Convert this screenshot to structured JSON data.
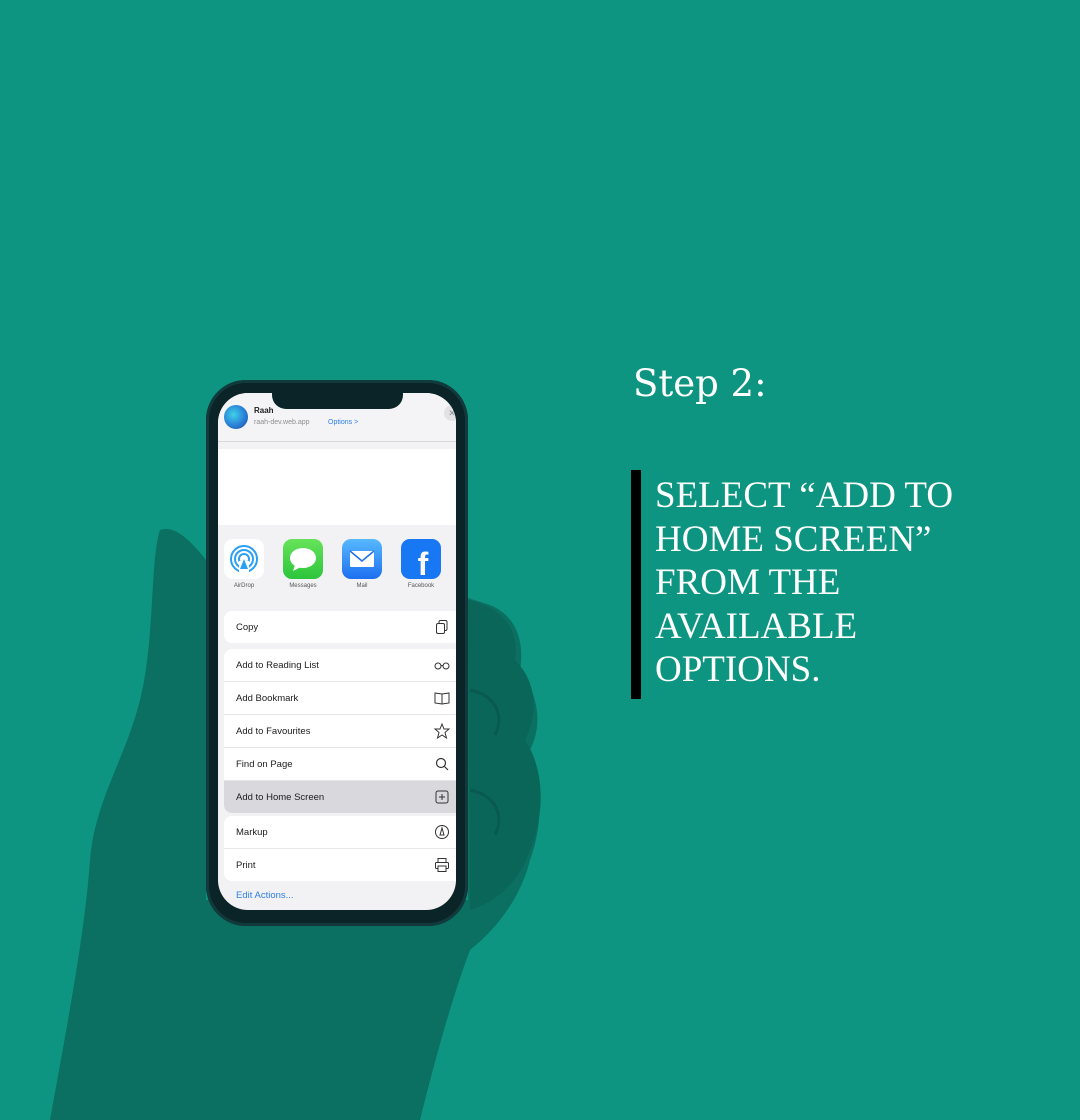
{
  "phone": {
    "share_header": {
      "app_name": "Raah",
      "url": "raah-dev.web.app",
      "options_link": "Options >",
      "close_icon": "close-icon"
    },
    "share_apps": [
      {
        "label": "AirDrop",
        "icon": "airdrop-icon"
      },
      {
        "label": "Messages",
        "icon": "messages-icon"
      },
      {
        "label": "Mail",
        "icon": "mail-icon"
      },
      {
        "label": "Facebook",
        "icon": "facebook-icon"
      }
    ],
    "actions_group1": [
      {
        "label": "Copy",
        "icon": "copy-icon"
      }
    ],
    "actions_group2": [
      {
        "label": "Add to Reading List",
        "icon": "glasses-icon"
      },
      {
        "label": "Add Bookmark",
        "icon": "book-icon"
      },
      {
        "label": "Add to Favourites",
        "icon": "star-icon"
      },
      {
        "label": "Find on Page",
        "icon": "search-icon"
      },
      {
        "label": "Add to Home Screen",
        "icon": "add-square-icon",
        "selected": true
      }
    ],
    "actions_group3": [
      {
        "label": "Markup",
        "icon": "markup-icon"
      },
      {
        "label": "Print",
        "icon": "printer-icon"
      }
    ],
    "edit_actions": "Edit Actions..."
  },
  "instruction": {
    "step": "Step 2:",
    "line1": "SELECT “ADD TO",
    "line2": "HOME SCREEN”",
    "line3": "FROM THE",
    "line4": "AVAILABLE",
    "line5": "OPTIONS."
  },
  "colors": {
    "background": "#0e9582",
    "selected_row": "#d8d8dd",
    "link_blue": "#2f7fe8"
  }
}
